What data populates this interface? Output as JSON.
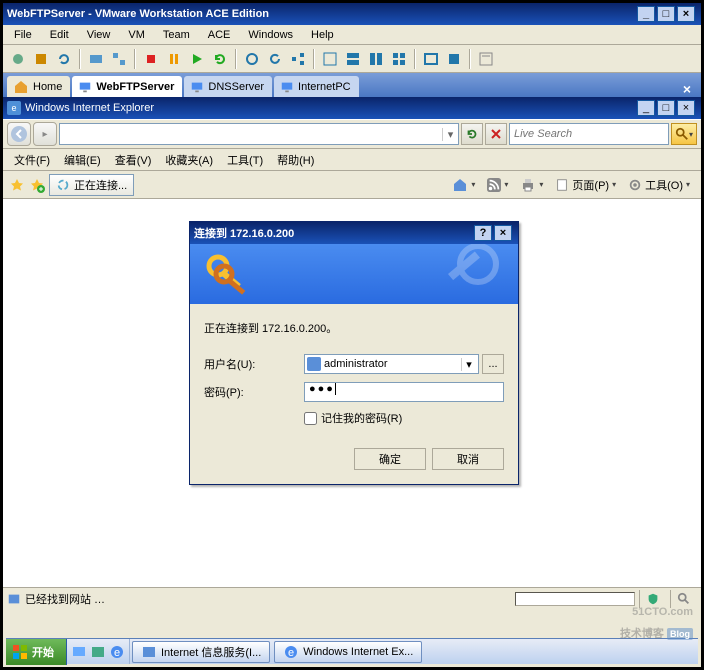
{
  "vmware": {
    "title": "WebFTPServer - VMware Workstation ACE Edition",
    "menu": {
      "file": "File",
      "edit": "Edit",
      "view": "View",
      "vm": "VM",
      "team": "Team",
      "ace": "ACE",
      "windows": "Windows",
      "help": "Help"
    },
    "tabs": {
      "home": "Home",
      "webftp": "WebFTPServer",
      "dns": "DNSServer",
      "ipc": "InternetPC"
    }
  },
  "ie": {
    "title": "Windows Internet Explorer",
    "menu": {
      "file": "文件(F)",
      "edit": "编辑(E)",
      "view": "查看(V)",
      "fav": "收藏夹(A)",
      "tools": "工具(T)",
      "help": "帮助(H)"
    },
    "search_ph": "Live Search",
    "tab_label": "正在连接...",
    "toolbar": {
      "page": "页面(P)",
      "tools": "工具(O)"
    },
    "status": "已经找到网站 …"
  },
  "dialog": {
    "title": "连接到 172.16.0.200",
    "connecting": "正在连接到 172.16.0.200。",
    "user_lbl": "用户名(U):",
    "pw_lbl": "密码(P):",
    "user_val": "administrator",
    "pw_val": "●●●",
    "remember": "记住我的密码(R)",
    "ok": "确定",
    "cancel": "取消"
  },
  "taskbar": {
    "start": "开始",
    "app1": "Internet 信息服务(I...",
    "app2": "Windows Internet Ex..."
  },
  "watermark": {
    "site": "51CTO.com",
    "sub": "技术博客",
    "badge": "Blog"
  }
}
